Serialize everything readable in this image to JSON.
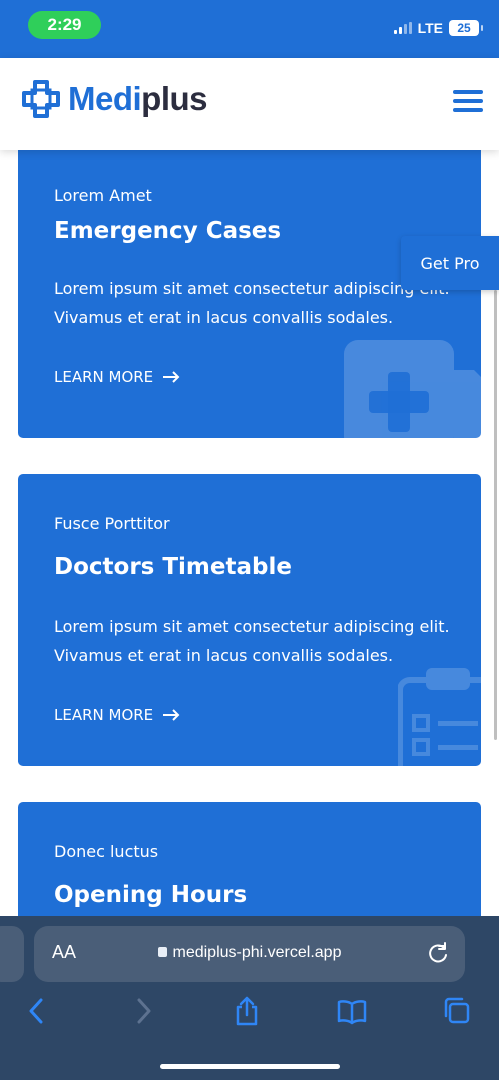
{
  "status_bar": {
    "time": "2:29",
    "network": "LTE",
    "battery": "25"
  },
  "header": {
    "logo_part1": "Medi",
    "logo_part2": "plus"
  },
  "get_pro": "Get Pro",
  "cards": [
    {
      "subtitle": "Lorem Amet",
      "title": "Emergency Cases",
      "desc": "Lorem ipsum sit amet consectetur adipiscing elit. Vivamus et erat in lacus convallis sodales.",
      "link": "LEARN MORE",
      "icon": "first-aid-kit-icon"
    },
    {
      "subtitle": "Fusce Porttitor",
      "title": "Doctors Timetable",
      "desc": "Lorem ipsum sit amet consectetur adipiscing elit. Vivamus et erat in lacus convallis sodales.",
      "link": "LEARN MORE",
      "icon": "clipboard-checklist-icon"
    },
    {
      "subtitle": "Donec luctus",
      "title": "Opening Hours"
    }
  ],
  "browser": {
    "aa_label": "AA",
    "url": "mediplus-phi.vercel.app"
  },
  "colors": {
    "primary": "#1f6fd6",
    "dark_text": "#2c2d3f",
    "status_green": "#2fcf5a",
    "browser_bg": "#2e4766"
  }
}
